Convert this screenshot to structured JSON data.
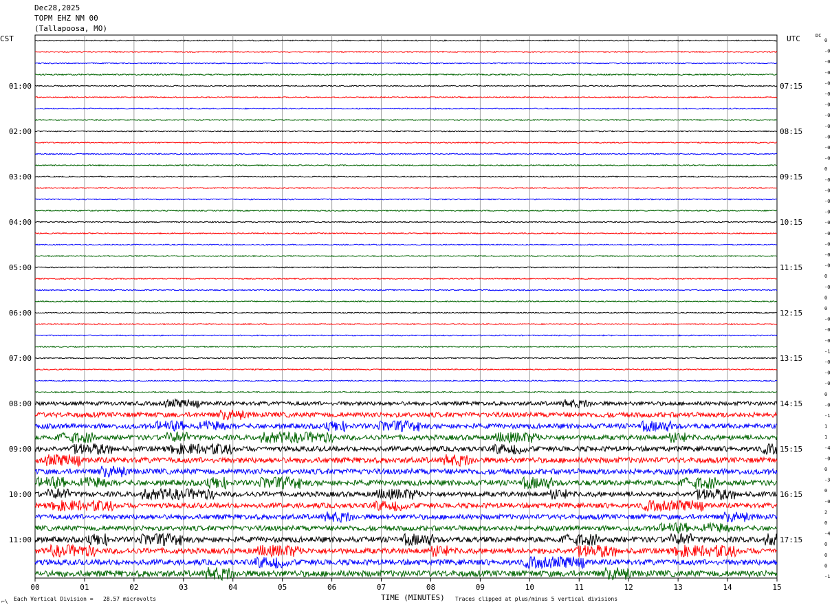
{
  "header": {
    "date": "Dec28,2025",
    "station": "TOPM EHZ NM 00",
    "location": "(Tallapoosa, MO)"
  },
  "left_timezone": "CST",
  "right_timezone": "UTC",
  "dc_label": "DC",
  "footer": {
    "corner_mark": "⌐\\",
    "scale_note": "Each Vertical Division =   28.57 microvolts",
    "xlabel": "TIME (MINUTES)",
    "clip_note": "Traces clipped at plus/minus 5 vertical divisions"
  },
  "colors": {
    "trace_cycle": [
      "#000000",
      "#ff0000",
      "#0000ff",
      "#006400"
    ],
    "grid": "#a0a0a0"
  },
  "chart_data": {
    "type": "line",
    "title": "",
    "xlabel": "TIME (MINUTES)",
    "ylabel": "",
    "xlim": [
      0,
      15
    ],
    "x_ticks": [
      "00",
      "01",
      "02",
      "03",
      "04",
      "05",
      "06",
      "07",
      "08",
      "09",
      "10",
      "11",
      "12",
      "13",
      "14",
      "15"
    ],
    "left_hour_labels": [
      "01:00",
      "02:00",
      "03:00",
      "04:00",
      "05:00",
      "06:00",
      "07:00",
      "08:00",
      "09:00",
      "10:00",
      "11:00"
    ],
    "right_hour_labels": [
      "07:15",
      "08:15",
      "09:15",
      "10:15",
      "11:15",
      "12:15",
      "13:15",
      "14:15",
      "15:15",
      "16:15",
      "17:15"
    ],
    "trace_count": 48,
    "traces_per_hour": 4,
    "dc_offsets": [
      "0",
      "-0",
      "-0",
      "-0",
      "-0",
      "-0",
      "-0",
      "-0",
      "-0",
      "-0",
      "-0",
      "-0",
      "0",
      "-0",
      "-0",
      "-0",
      "-0",
      "-0",
      "-0",
      "-0",
      "-0",
      "-0",
      "0",
      "-0",
      "0",
      "0",
      "-0",
      "-0",
      "-0",
      "-1",
      "-0",
      "-0",
      "-0",
      "0",
      "-0",
      "-1",
      "1",
      "1",
      "-4",
      "-0",
      "0",
      "-3",
      "0",
      "-0",
      "2",
      "0",
      "-4",
      "0",
      "0",
      "0",
      "-1"
    ],
    "trace_activity": [
      1,
      1,
      1,
      1.2,
      1,
      1,
      1,
      1,
      1,
      1,
      1,
      1,
      1,
      1,
      1,
      1,
      1,
      1,
      1,
      1,
      1,
      1,
      1,
      1,
      1,
      1,
      1,
      1,
      1,
      1,
      1,
      1.2,
      3.5,
      4.5,
      4.5,
      4.5,
      4.5,
      5,
      5,
      5,
      4.5,
      4.5,
      4.5,
      4.5,
      5,
      5,
      5,
      5.5
    ]
  }
}
